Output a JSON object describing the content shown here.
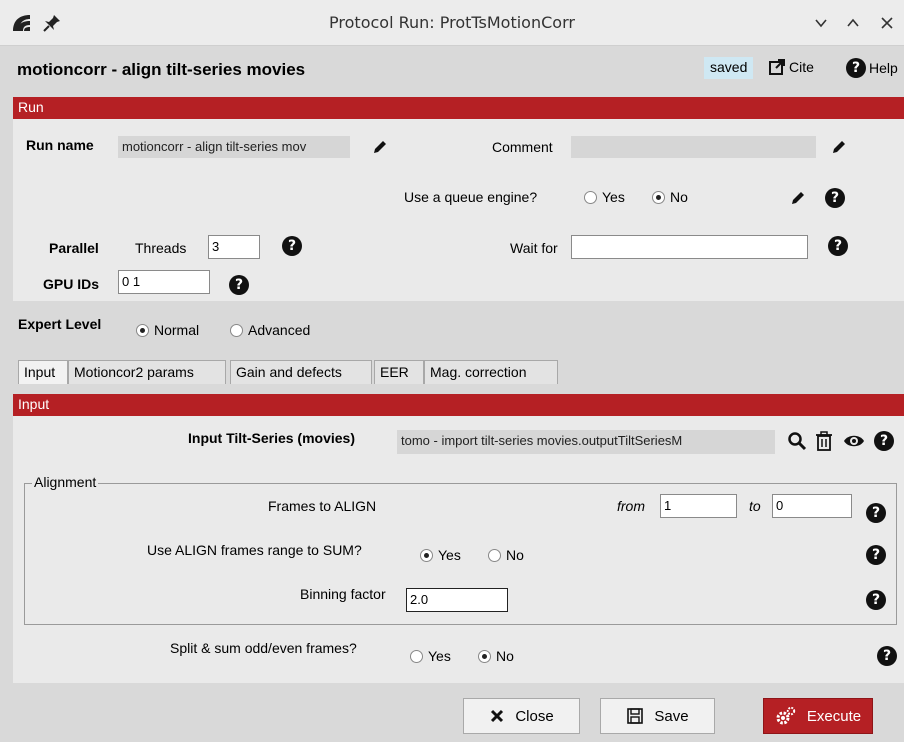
{
  "window": {
    "title": "Protocol Run: ProtTsMotionCorr"
  },
  "header": {
    "title": "motioncorr - align tilt-series movies",
    "saved": "saved",
    "cite": "Cite",
    "help": "Help"
  },
  "run_section": {
    "title": "Run",
    "run_name_label": "Run name",
    "run_name_value": "motioncorr - align tilt-series mov",
    "comment_label": "Comment",
    "comment_value": "",
    "queue_label": "Use a queue engine?",
    "queue_yes": "Yes",
    "queue_no": "No",
    "queue_selected": "No",
    "parallel_label": "Parallel",
    "threads_label": "Threads",
    "threads_value": "3",
    "wait_for_label": "Wait for",
    "wait_for_value": "",
    "gpu_label": "GPU IDs",
    "gpu_value": "0 1"
  },
  "expert": {
    "label": "Expert Level",
    "normal": "Normal",
    "advanced": "Advanced",
    "selected": "Normal"
  },
  "tabs": [
    {
      "label": "Input"
    },
    {
      "label": "Motioncor2 params"
    },
    {
      "label": "Gain and defects"
    },
    {
      "label": "EER"
    },
    {
      "label": "Mag. correction"
    }
  ],
  "input_section": {
    "title": "Input",
    "tilt_series_label": "Input Tilt-Series (movies)",
    "tilt_series_value": "tomo - import tilt-series movies.outputTiltSeriesM",
    "alignment_title": "Alignment",
    "frames_label": "Frames to ALIGN",
    "from_label": "from",
    "from_value": "1",
    "to_label": "to",
    "to_value": "0",
    "use_range_label": "Use ALIGN frames range to SUM?",
    "use_range_yes": "Yes",
    "use_range_no": "No",
    "use_range_selected": "Yes",
    "binning_label": "Binning factor",
    "binning_value": "2.0",
    "split_label": "Split & sum odd/even frames?",
    "split_yes": "Yes",
    "split_no": "No",
    "split_selected": "No"
  },
  "buttons": {
    "close": "Close",
    "save": "Save",
    "execute": "Execute"
  },
  "help_glyph": "?",
  "colors": {
    "section_bar": "#b52024",
    "saved_badge": "#cfe8f3"
  }
}
